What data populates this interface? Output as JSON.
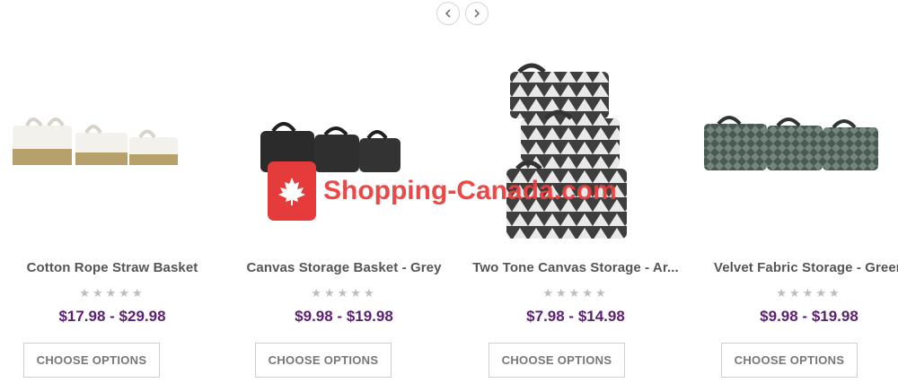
{
  "carousel": {
    "prev_icon": "chevron-left-icon",
    "next_icon": "chevron-right-icon"
  },
  "products": [
    {
      "title": "Cotton Rope Straw Basket",
      "price": "$17.98 - $29.98",
      "button": "CHOOSE OPTIONS",
      "rating": "★★★★★"
    },
    {
      "title": "Canvas Storage Basket - Grey",
      "price": "$9.98 - $19.98",
      "button": "CHOOSE OPTIONS",
      "rating": "★★★★★"
    },
    {
      "title": "Two Tone Canvas Storage - Ar...",
      "price": "$7.98 - $14.98",
      "button": "CHOOSE OPTIONS",
      "rating": "★★★★★"
    },
    {
      "title": "Velvet Fabric Storage - Green",
      "price": "$9.98 - $19.98",
      "button": "CHOOSE OPTIONS",
      "rating": "★★★★★"
    }
  ],
  "watermark": {
    "text": "Shopping-Canada.com"
  },
  "colors": {
    "price": "#5b1f73",
    "watermark": "#e53b3b"
  }
}
